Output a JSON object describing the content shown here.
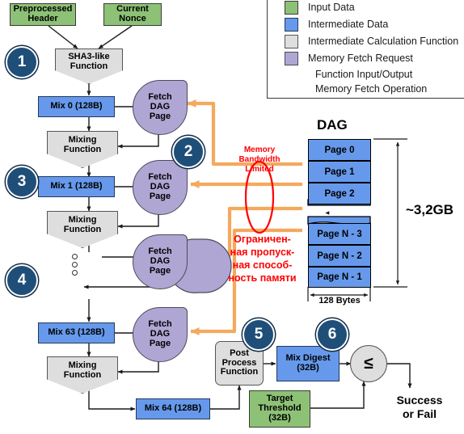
{
  "diagram": {
    "title": "Ethash mining algorithm dataflow",
    "colors": {
      "input_data": "#8DC176",
      "intermediate_data": "#6699EB",
      "intermediate_function": "#DEDEDE",
      "memory_fetch": "#B0A6D4",
      "step_circle": "#1F4E79",
      "memory_arrow": "#F4A95D",
      "warning_text": "#FF0000"
    }
  },
  "legend": {
    "items": [
      {
        "label": "Input Data",
        "swatch": "green-swatch"
      },
      {
        "label": "Intermediate Data",
        "swatch": "blue-swatch"
      },
      {
        "label": "Intermediate Calculation Function",
        "swatch": "gray-swatch"
      },
      {
        "label": "Memory Fetch Request",
        "swatch": "purple-swatch"
      }
    ],
    "arrows": [
      {
        "label": "Function Input/Output",
        "style": "black-arrow"
      },
      {
        "label": "Memory Fetch Operation",
        "style": "orange-double-arrow"
      }
    ]
  },
  "steps": {
    "one": "1",
    "two": "2",
    "three": "3",
    "four": "4",
    "five": "5",
    "six": "6"
  },
  "nodes": {
    "preprocessed_header": "Preprocessed\nHeader",
    "current_nonce": "Current\nNonce",
    "sha3": "SHA3-like\nFunction",
    "mix0": "Mix 0 (128B)",
    "mix1": "Mix 1 (128B)",
    "mix63": "Mix 63 (128B)",
    "mix64": "Mix 64 (128B)",
    "mixing_function": "Mixing\nFunction",
    "fetch_dag_page": "Fetch\nDAG\nPage",
    "post_process": "Post\nProcess\nFunction",
    "mix_digest": "Mix Digest\n(32B)",
    "target_threshold": "Target\nThreshold\n(32B)",
    "comparator": "≤",
    "result": "Success\nor Fail"
  },
  "dag": {
    "title": "DAG",
    "pages_top": [
      "Page 0",
      "Page 1",
      "Page 2"
    ],
    "pages_bottom": [
      "Page N - 3",
      "Page N - 2",
      "Page N - 1"
    ],
    "size_label": "~3,2GB",
    "width_label": "128 Bytes"
  },
  "annotations": {
    "memory_bandwidth_en": "Memory\nBandwidth\nLimited",
    "memory_bandwidth_ru": "Ограничен-\nная пропуск-\nная способ-\nность памяти"
  }
}
